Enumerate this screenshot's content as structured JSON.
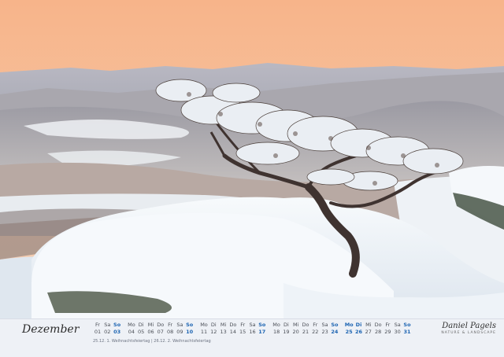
{
  "calendar": {
    "month": "Dezember",
    "weeks": [
      {
        "days": [
          {
            "dn": "Fr",
            "num": "01"
          },
          {
            "dn": "Sa",
            "num": "02"
          },
          {
            "dn": "So",
            "num": "03",
            "highlight": true
          }
        ]
      },
      {
        "days": [
          {
            "dn": "Mo",
            "num": "04"
          },
          {
            "dn": "Di",
            "num": "05"
          },
          {
            "dn": "Mi",
            "num": "06"
          },
          {
            "dn": "Do",
            "num": "07"
          },
          {
            "dn": "Fr",
            "num": "08"
          },
          {
            "dn": "Sa",
            "num": "09"
          },
          {
            "dn": "So",
            "num": "10",
            "highlight": true
          }
        ]
      },
      {
        "days": [
          {
            "dn": "Mo",
            "num": "11"
          },
          {
            "dn": "Di",
            "num": "12"
          },
          {
            "dn": "Mi",
            "num": "13"
          },
          {
            "dn": "Do",
            "num": "14"
          },
          {
            "dn": "Fr",
            "num": "15"
          },
          {
            "dn": "Sa",
            "num": "16"
          },
          {
            "dn": "So",
            "num": "17",
            "highlight": true
          }
        ]
      },
      {
        "days": [
          {
            "dn": "Mo",
            "num": "18"
          },
          {
            "dn": "Di",
            "num": "19"
          },
          {
            "dn": "Mi",
            "num": "20"
          },
          {
            "dn": "Do",
            "num": "21"
          },
          {
            "dn": "Fr",
            "num": "22"
          },
          {
            "dn": "Sa",
            "num": "23"
          },
          {
            "dn": "So",
            "num": "24",
            "highlight": true
          }
        ]
      },
      {
        "days": [
          {
            "dn": "Mo",
            "num": "25",
            "highlight": true
          },
          {
            "dn": "Di",
            "num": "26",
            "highlight": true
          },
          {
            "dn": "Mi",
            "num": "27"
          },
          {
            "dn": "Do",
            "num": "28"
          },
          {
            "dn": "Fr",
            "num": "29"
          },
          {
            "dn": "Sa",
            "num": "30"
          },
          {
            "dn": "So",
            "num": "31",
            "highlight": true
          }
        ]
      }
    ],
    "notes": "25.12. 1. Weihnachtsfeiertag  |  26.12. 2. Weihnachtsfeiertag"
  },
  "brand": {
    "script": "Daniel Pagels",
    "tagline": "NATURE & LANDSCAPE"
  },
  "colors": {
    "sky_top": "#f6b98d",
    "sky_glow": "#f3c2a0",
    "haze": "#bfc3cd",
    "snow": "#f4f8fb",
    "highlight": "#1f66b3"
  }
}
